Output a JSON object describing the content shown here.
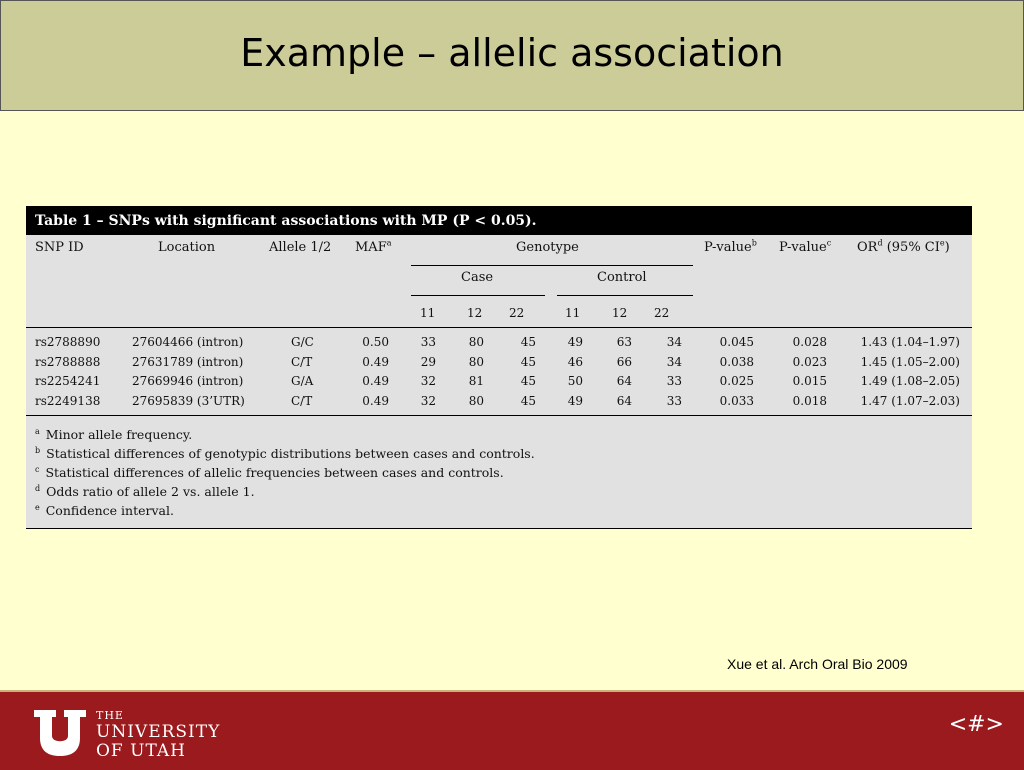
{
  "slide": {
    "title": "Example – allelic association",
    "citation": "Xue et al. Arch Oral Bio 2009",
    "page_marker": "<#>"
  },
  "logo": {
    "line1": "THE",
    "line2": "UNIVERSITY",
    "line3": "OF UTAH"
  },
  "table": {
    "caption": "Table 1 – SNPs with significant associations with MP (P < 0.05).",
    "headers": {
      "snp_id": "SNP ID",
      "location": "Location",
      "allele": "Allele 1/2",
      "maf": "MAF",
      "maf_sup": "a",
      "genotype": "Genotype",
      "case": "Case",
      "control": "Control",
      "sub11": "11",
      "sub12": "12",
      "sub22": "22",
      "pvalue_b": "P-value",
      "pvalue_b_sup": "b",
      "pvalue_c": "P-value",
      "pvalue_c_sup": "c",
      "or_prefix": "OR",
      "or_sup": "d",
      "or_mid": " (95% CI",
      "or_sup2": "e",
      "or_suffix": ")"
    },
    "rows": [
      {
        "snp": "rs2788890",
        "location": "27604466 (intron)",
        "allele": "G/C",
        "maf": "0.50",
        "case11": "33",
        "case12": "80",
        "case22": "45",
        "ctl11": "49",
        "ctl12": "63",
        "ctl22": "34",
        "p_geno": "0.045",
        "p_allele": "0.028",
        "or": "1.43 (1.04–1.97)"
      },
      {
        "snp": "rs2788888",
        "location": "27631789 (intron)",
        "allele": "C/T",
        "maf": "0.49",
        "case11": "29",
        "case12": "80",
        "case22": "45",
        "ctl11": "46",
        "ctl12": "66",
        "ctl22": "34",
        "p_geno": "0.038",
        "p_allele": "0.023",
        "or": "1.45 (1.05–2.00)"
      },
      {
        "snp": "rs2254241",
        "location": "27669946 (intron)",
        "allele": "G/A",
        "maf": "0.49",
        "case11": "32",
        "case12": "81",
        "case22": "45",
        "ctl11": "50",
        "ctl12": "64",
        "ctl22": "33",
        "p_geno": "0.025",
        "p_allele": "0.015",
        "or": "1.49 (1.08–2.05)"
      },
      {
        "snp": "rs2249138",
        "location": "27695839 (3’UTR)",
        "allele": "C/T",
        "maf": "0.49",
        "case11": "32",
        "case12": "80",
        "case22": "45",
        "ctl11": "49",
        "ctl12": "64",
        "ctl22": "33",
        "p_geno": "0.033",
        "p_allele": "0.018",
        "or": "1.47 (1.07–2.03)"
      }
    ],
    "footnotes": [
      {
        "sup": "a",
        "text": "Minor allele frequency."
      },
      {
        "sup": "b",
        "text": "Statistical differences of genotypic distributions between cases and controls."
      },
      {
        "sup": "c",
        "text": "Statistical differences of allelic frequencies between cases and controls."
      },
      {
        "sup": "d",
        "text": "Odds ratio of allele 2 vs. allele 1."
      },
      {
        "sup": "e",
        "text": "Confidence interval."
      }
    ]
  },
  "colors": {
    "title_bg": "#cccc99",
    "slide_bg": "#ffffd0",
    "footer_bg": "#9b1a1e",
    "table_bg": "#e1e1e1"
  }
}
